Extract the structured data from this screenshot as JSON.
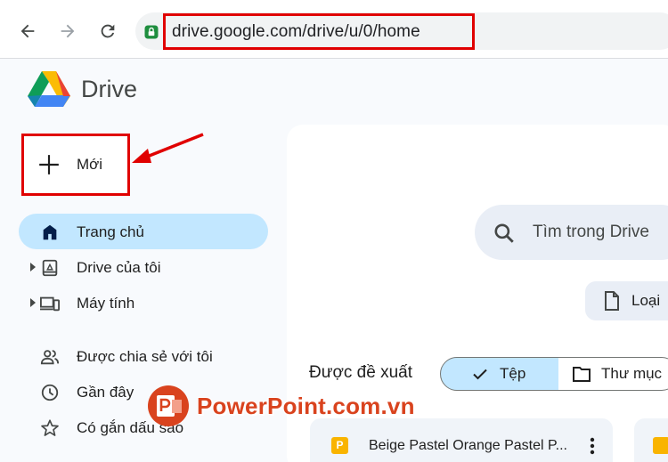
{
  "browser": {
    "url": "drive.google.com/drive/u/0/home"
  },
  "app": {
    "title": "Drive"
  },
  "new_button": {
    "label": "Mới"
  },
  "sidebar": {
    "items": [
      {
        "label": "Trang chủ",
        "icon": "home-icon"
      },
      {
        "label": "Drive của tôi",
        "icon": "my-drive-icon"
      },
      {
        "label": "Máy tính",
        "icon": "computers-icon"
      },
      {
        "label": "Được chia sẻ với tôi",
        "icon": "shared-people-icon"
      },
      {
        "label": "Gần đây",
        "icon": "clock-icon"
      },
      {
        "label": "Có gắn dấu sao",
        "icon": "star-icon"
      }
    ]
  },
  "main": {
    "search_placeholder": "Tìm trong Drive",
    "type_filter": "Loại",
    "suggested_label": "Được đề xuất",
    "segments": {
      "files": "Tệp",
      "folders": "Thư mục"
    },
    "files": [
      {
        "name": "Beige Pastel Orange Pastel P...",
        "icon_letter": "P"
      }
    ]
  },
  "watermark": {
    "text": "PowerPoint.com.vn"
  },
  "colors": {
    "annotation_red": "#e00000",
    "active_nav": "#c2e7ff",
    "slides_yellow": "#f9b400"
  }
}
